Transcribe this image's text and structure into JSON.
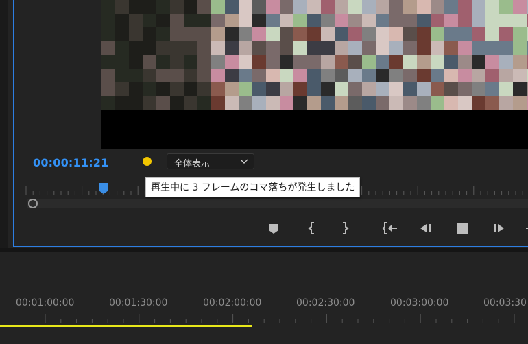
{
  "program_monitor": {
    "timecode": "00:00:11:21",
    "dropped_frame_indicator_color": "#f2c600",
    "zoom_dropdown": {
      "selected": "全体表示"
    },
    "tooltip": "再生中に 3 フレームのコマ落ちが発生しました",
    "transport_buttons": [
      {
        "name": "add-marker-button",
        "icon": "marker-icon"
      },
      {
        "name": "mark-in-button",
        "icon": "mark-in-icon"
      },
      {
        "name": "mark-out-button",
        "icon": "mark-out-icon"
      },
      {
        "name": "go-to-in-button",
        "icon": "go-to-in-icon"
      },
      {
        "name": "step-back-button",
        "icon": "step-back-icon"
      },
      {
        "name": "stop-button",
        "icon": "stop-icon"
      },
      {
        "name": "step-forward-button",
        "icon": "step-forward-icon"
      }
    ],
    "accent_color": "#3391f5"
  },
  "timeline": {
    "time_labels": [
      "00:01:00:00",
      "00:01:30:00",
      "00:02:00:00",
      "00:02:30:00",
      "00:03:00:00",
      "00:03:30"
    ],
    "work_area_color": "#e8e81a"
  }
}
